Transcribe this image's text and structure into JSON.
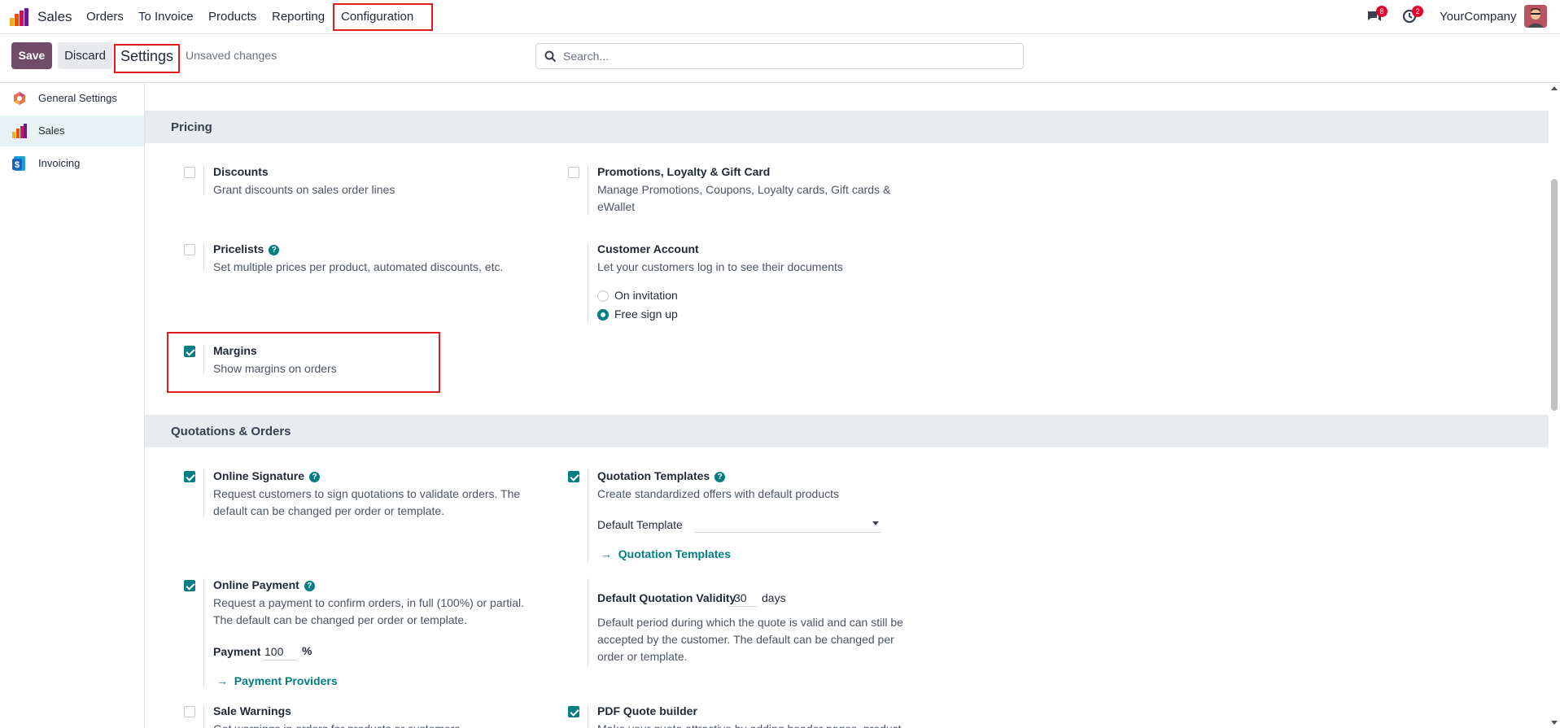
{
  "navbar": {
    "app_name": "Sales",
    "menu": [
      "Orders",
      "To Invoice",
      "Products",
      "Reporting",
      "Configuration"
    ],
    "messages_badge": "8",
    "activities_badge": "2",
    "company": "YourCompany"
  },
  "controlbar": {
    "save_label": "Save",
    "discard_label": "Discard",
    "breadcrumb": "Settings",
    "unsaved": "Unsaved changes",
    "search_placeholder": "Search..."
  },
  "sidebar": {
    "items": [
      {
        "label": "General Settings",
        "icon": "odoo-settings-icon",
        "active": false
      },
      {
        "label": "Sales",
        "icon": "sales-app-icon",
        "active": true
      },
      {
        "label": "Invoicing",
        "icon": "invoicing-app-icon",
        "active": false
      }
    ]
  },
  "pricing": {
    "title": "Pricing",
    "discounts": {
      "title": "Discounts",
      "desc": "Grant discounts on sales order lines",
      "checked": false
    },
    "promotions": {
      "title": "Promotions, Loyalty & Gift Card",
      "desc": "Manage Promotions, Coupons, Loyalty cards, Gift cards & eWallet",
      "checked": false
    },
    "pricelists": {
      "title": "Pricelists",
      "desc": "Set multiple prices per product, automated discounts, etc.",
      "checked": false
    },
    "customer_account": {
      "title": "Customer Account",
      "desc": "Let your customers log in to see their documents",
      "options": [
        "On invitation",
        "Free sign up"
      ],
      "selected": "Free sign up"
    },
    "margins": {
      "title": "Margins",
      "desc": "Show margins on orders",
      "checked": true
    }
  },
  "quotations": {
    "title": "Quotations & Orders",
    "online_signature": {
      "title": "Online Signature",
      "desc": "Request customers to sign quotations to validate orders. The default can be changed per order or template.",
      "checked": true
    },
    "quotation_templates": {
      "title": "Quotation Templates",
      "desc": "Create standardized offers with default products",
      "checked": true,
      "default_template_label": "Default Template",
      "default_template_value": "",
      "link": "Quotation Templates"
    },
    "online_payment": {
      "title": "Online Payment",
      "desc": "Request a payment to confirm orders, in full (100%) or partial. The default can be changed per order or template.",
      "checked": true,
      "payment_label": "Payment",
      "payment_value": "100",
      "payment_unit": "%",
      "link": "Payment Providers"
    },
    "validity": {
      "title": "Default Quotation Validity",
      "value": "30",
      "unit": "days",
      "desc": "Default period during which the quote is valid and can still be accepted by the customer. The default can be changed per order or template."
    },
    "sale_warnings": {
      "title": "Sale Warnings",
      "desc": "Get warnings in orders for products or customers",
      "checked": false
    },
    "pdf_builder": {
      "title": "PDF Quote builder",
      "desc": "Make your quote attractive by adding header pages, product descriptions and footer pages to your quote.",
      "checked": true
    }
  },
  "colors": {
    "accent": "#714b67",
    "teal": "#017e84",
    "highlight": "#e41c1c"
  }
}
